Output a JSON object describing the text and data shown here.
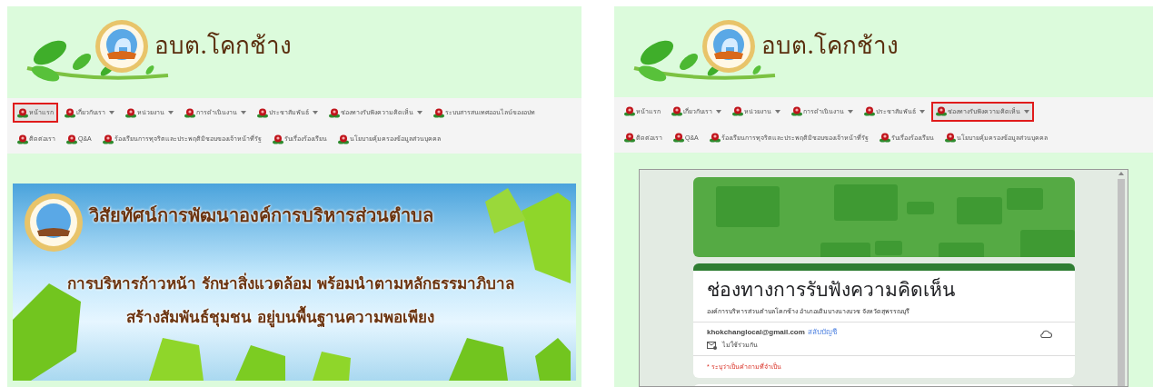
{
  "panels": [
    {
      "header": {
        "site_name": "อบต.โคกช้าง"
      },
      "menu": {
        "primary_items": [
          {
            "label": "หน้าแรก",
            "dropdown": false,
            "selected": true
          },
          {
            "label": "เกี่ยวกับเรา",
            "dropdown": true,
            "selected": false
          },
          {
            "label": "หน่วยงาน",
            "dropdown": true,
            "selected": false
          },
          {
            "label": "การดำเนินงาน",
            "dropdown": true,
            "selected": false
          },
          {
            "label": "ประชาสัมพันธ์",
            "dropdown": true,
            "selected": false
          },
          {
            "label": "ช่องทางรับฟังความคิดเห็น",
            "dropdown": true,
            "selected": false
          },
          {
            "label": "ระบบสารสนเทศออนไลน์ของอปท",
            "dropdown": false,
            "selected": false
          }
        ],
        "secondary_items": [
          {
            "label": "ติดต่อเรา",
            "dropdown": false,
            "selected": false
          },
          {
            "label": "Q&A",
            "dropdown": false,
            "selected": false
          },
          {
            "label": "ร้องเรียนการทุจริตและประพฤติมิชอบของเจ้าหน้าที่รัฐ",
            "dropdown": false,
            "selected": false
          },
          {
            "label": "รับเรื่องร้องเรียน",
            "dropdown": false,
            "selected": false
          },
          {
            "label": "นโยบายคุ้มครองข้อมูลส่วนบุคคล",
            "dropdown": false,
            "selected": false
          }
        ]
      },
      "content": {
        "kind": "banner",
        "lines": [
          "วิสัยทัศน์การพัฒนาองค์การบริหารส่วนตำบล",
          "การบริหารก้าวหน้า รักษาสิ่งแวดล้อม พร้อมนำตามหลักธรรมาภิบาล",
          "สร้างสัมพันธ์ชุมชน อยู่บนพื้นฐานความพอเพียง"
        ]
      }
    },
    {
      "header": {
        "site_name": "อบต.โคกช้าง"
      },
      "menu": {
        "primary_items": [
          {
            "label": "หน้าแรก",
            "dropdown": false,
            "selected": false
          },
          {
            "label": "เกี่ยวกับเรา",
            "dropdown": true,
            "selected": false
          },
          {
            "label": "หน่วยงาน",
            "dropdown": true,
            "selected": false
          },
          {
            "label": "การดำเนินงาน",
            "dropdown": true,
            "selected": false
          },
          {
            "label": "ประชาสัมพันธ์",
            "dropdown": true,
            "selected": false
          },
          {
            "label": "ช่องทางรับฟังความคิดเห็น",
            "dropdown": true,
            "selected": true
          }
        ],
        "secondary_items": [
          {
            "label": "ติดต่อเรา",
            "dropdown": false,
            "selected": false
          },
          {
            "label": "Q&A",
            "dropdown": false,
            "selected": false
          },
          {
            "label": "ร้องเรียนการทุจริตและประพฤติมิชอบของเจ้าหน้าที่รัฐ",
            "dropdown": false,
            "selected": false
          },
          {
            "label": "รับเรื่องร้องเรียน",
            "dropdown": false,
            "selected": false
          },
          {
            "label": "นโยบายคุ้มครองข้อมูลส่วนบุคคล",
            "dropdown": false,
            "selected": false
          }
        ]
      },
      "content": {
        "kind": "form",
        "title": "ช่องทางการรับฟังความคิดเห็น",
        "description": "องค์การบริหารส่วนตำบลโคกช้าง อำเภอเดิมบางนางบวช จังหวัดสุพรรณบุรี",
        "account": "khokchanglocal@gmail.com",
        "switch_account": "สลับบัญชี",
        "sharing": "ไม่ใช้ร่วมกัน",
        "required_note": "* ระบุว่าเป็นคำถามที่จำเป็น"
      }
    }
  ]
}
